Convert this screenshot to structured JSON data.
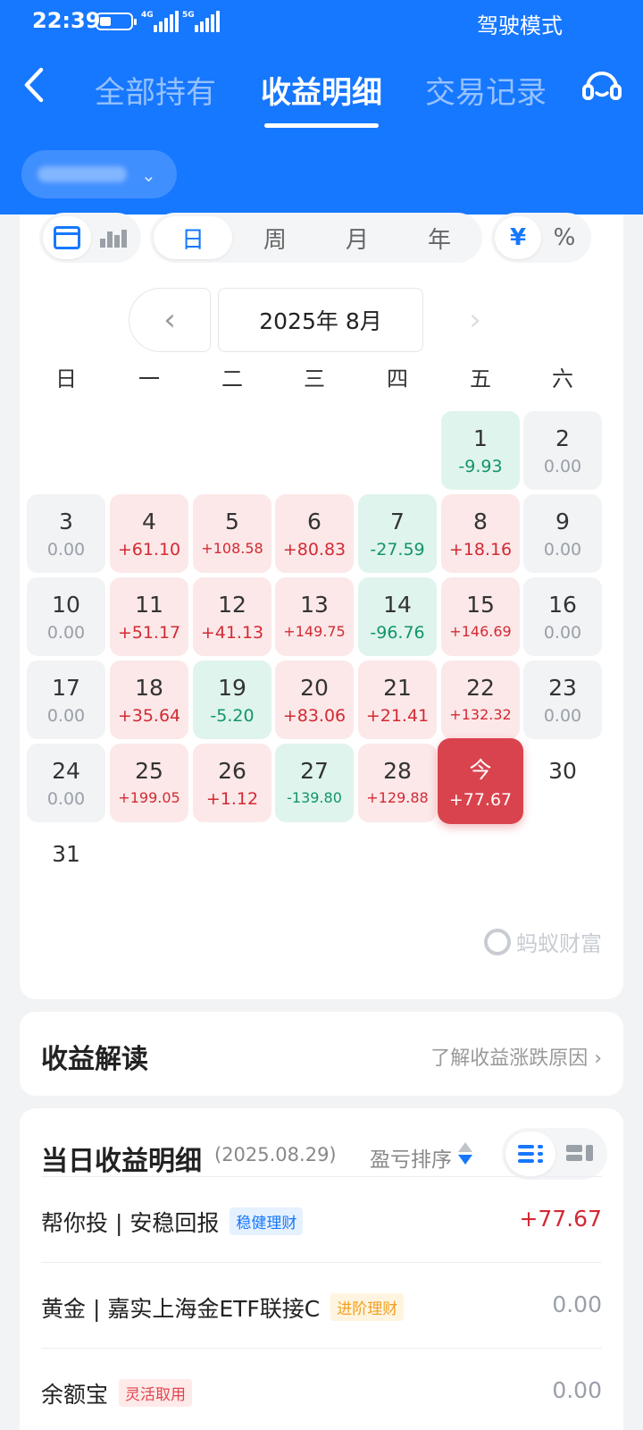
{
  "status_bar": {
    "time": "22:39",
    "net1": "4G",
    "net2": "5G",
    "mode": "驾驶模式"
  },
  "nav": {
    "tabs": [
      {
        "label": "全部持有",
        "active": false
      },
      {
        "label": "收益明细",
        "active": true
      },
      {
        "label": "交易记录",
        "active": false
      }
    ],
    "back_icon": "chevron-left-icon",
    "service_icon": "headset-icon"
  },
  "calendar": {
    "period_tabs": [
      {
        "label": "日",
        "active": true
      },
      {
        "label": "周",
        "active": false
      },
      {
        "label": "月",
        "active": false
      },
      {
        "label": "年",
        "active": false
      }
    ],
    "unit_tabs": [
      {
        "label": "¥",
        "active": true
      },
      {
        "label": "%",
        "active": false
      }
    ],
    "month_label": "2025年 8月",
    "prev_glyph": "‹",
    "next_glyph": "›",
    "weekdays": [
      "日",
      "一",
      "二",
      "三",
      "四",
      "五",
      "六"
    ],
    "days": [
      {
        "num": "1",
        "val": "-9.93",
        "type": "loss"
      },
      {
        "num": "2",
        "val": "0.00",
        "type": "zero"
      },
      {
        "num": "3",
        "val": "0.00",
        "type": "zero"
      },
      {
        "num": "4",
        "val": "+61.10",
        "type": "gain"
      },
      {
        "num": "5",
        "val": "+108.58",
        "type": "gain"
      },
      {
        "num": "6",
        "val": "+80.83",
        "type": "gain"
      },
      {
        "num": "7",
        "val": "-27.59",
        "type": "loss"
      },
      {
        "num": "8",
        "val": "+18.16",
        "type": "gain"
      },
      {
        "num": "9",
        "val": "0.00",
        "type": "zero"
      },
      {
        "num": "10",
        "val": "0.00",
        "type": "zero"
      },
      {
        "num": "11",
        "val": "+51.17",
        "type": "gain"
      },
      {
        "num": "12",
        "val": "+41.13",
        "type": "gain"
      },
      {
        "num": "13",
        "val": "+149.75",
        "type": "gain"
      },
      {
        "num": "14",
        "val": "-96.76",
        "type": "loss"
      },
      {
        "num": "15",
        "val": "+146.69",
        "type": "gain"
      },
      {
        "num": "16",
        "val": "0.00",
        "type": "zero"
      },
      {
        "num": "17",
        "val": "0.00",
        "type": "zero"
      },
      {
        "num": "18",
        "val": "+35.64",
        "type": "gain"
      },
      {
        "num": "19",
        "val": "-5.20",
        "type": "loss"
      },
      {
        "num": "20",
        "val": "+83.06",
        "type": "gain"
      },
      {
        "num": "21",
        "val": "+21.41",
        "type": "gain"
      },
      {
        "num": "22",
        "val": "+132.32",
        "type": "gain"
      },
      {
        "num": "23",
        "val": "0.00",
        "type": "zero"
      },
      {
        "num": "24",
        "val": "0.00",
        "type": "zero"
      },
      {
        "num": "25",
        "val": "+199.05",
        "type": "gain"
      },
      {
        "num": "26",
        "val": "+1.12",
        "type": "gain"
      },
      {
        "num": "27",
        "val": "-139.80",
        "type": "loss"
      },
      {
        "num": "28",
        "val": "+129.88",
        "type": "gain"
      },
      {
        "num": "今",
        "val": "+77.67",
        "type": "today"
      },
      {
        "num": "30",
        "val": "",
        "type": "none"
      },
      {
        "num": "31",
        "val": "",
        "type": "none"
      }
    ],
    "watermark": "蚂蚁财富"
  },
  "interpretation": {
    "title": "收益解读",
    "link": "了解收益涨跌原因 ›"
  },
  "detail": {
    "title": "当日收益明细",
    "date": "(2025.08.29)",
    "sort_label": "盈亏排序",
    "rows": [
      {
        "name": "帮你投 | 安稳回报",
        "tag": "稳健理财",
        "tag_color": "blue",
        "value": "+77.67",
        "type": "gain"
      },
      {
        "name": "黄金 | 嘉实上海金ETF联接C",
        "tag": "进阶理财",
        "tag_color": "orange",
        "value": "0.00",
        "type": "zero"
      },
      {
        "name": "余额宝",
        "tag": "灵活取用",
        "tag_color": "red",
        "value": "0.00",
        "type": "zero"
      }
    ]
  },
  "colors": {
    "brand_blue": "#1677ff",
    "gain_red": "#d22a34",
    "loss_green": "#12956a",
    "today_red": "#d9434d"
  }
}
